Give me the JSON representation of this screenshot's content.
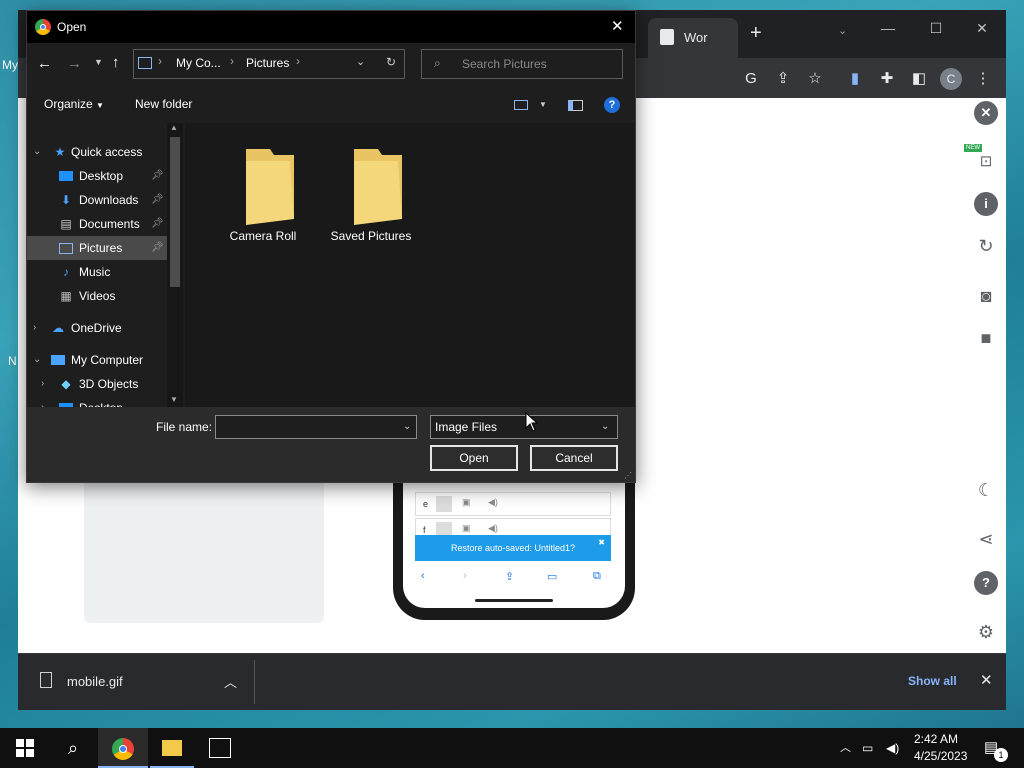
{
  "desktop": {
    "fragments": [
      "My",
      "N"
    ]
  },
  "chrome": {
    "tab_label": "Wor",
    "new_tab": "+",
    "profile_initial": "C",
    "new_badge": "NEW"
  },
  "phone": {
    "rows": [
      {
        "letter": "e"
      },
      {
        "letter": "f"
      }
    ],
    "restore_banner": "Restore auto-saved: Untitled1?",
    "restore_close": "✖"
  },
  "download_bar": {
    "file_name": "mobile.gif",
    "show_all": "Show all"
  },
  "dialog": {
    "title": "Open",
    "breadcrumb": [
      "My Co...",
      "Pictures"
    ],
    "search_placeholder": "Search Pictures",
    "organize": "Organize",
    "new_folder": "New folder",
    "nav_items": [
      {
        "label": "Quick access",
        "icon": "star-icon"
      },
      {
        "label": "Desktop",
        "icon": "desktop-folder-icon",
        "pinned": true
      },
      {
        "label": "Downloads",
        "icon": "download-arrow-icon",
        "pinned": true
      },
      {
        "label": "Documents",
        "icon": "document-icon",
        "pinned": true
      },
      {
        "label": "Pictures",
        "icon": "pictures-icon",
        "pinned": true,
        "selected": true
      },
      {
        "label": "Music",
        "icon": "music-note-icon"
      },
      {
        "label": "Videos",
        "icon": "film-icon"
      },
      {
        "label": "OneDrive",
        "icon": "cloud-icon"
      },
      {
        "label": "My Computer",
        "icon": "monitor-icon"
      },
      {
        "label": "3D Objects",
        "icon": "cube-icon"
      },
      {
        "label": "Desktop",
        "icon": "desktop-folder-icon"
      }
    ],
    "folders": [
      "Camera Roll",
      "Saved Pictures"
    ],
    "file_name_label": "File name:",
    "file_name_value": "",
    "file_type": "Image Files",
    "open_button": "Open",
    "cancel_button": "Cancel"
  },
  "taskbar": {
    "time": "2:42 AM",
    "date": "4/25/2023",
    "notification_count": "1"
  },
  "colors": {
    "dialog_bg": "#1e1e1e",
    "folder_yellow": "#f3d77a",
    "selected_nav": "#4a4a4a",
    "accent_blue": "#1e9be9",
    "link_blue": "#8ab4f8"
  }
}
